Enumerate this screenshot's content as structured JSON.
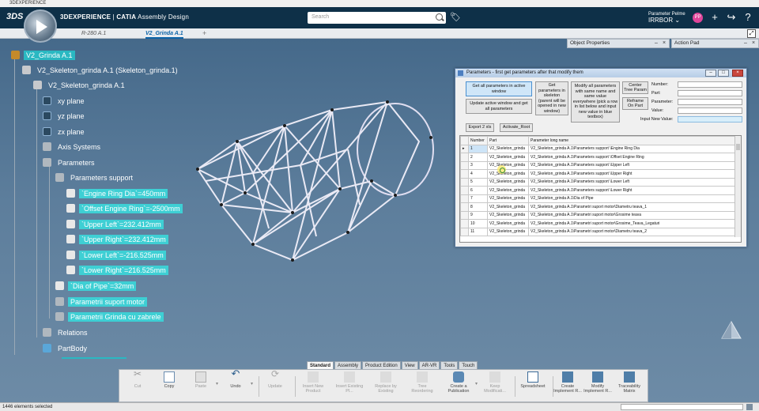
{
  "window": {
    "title": "3DEXPERIENCE"
  },
  "header": {
    "logo": "3DS",
    "brand": "3DEXPERIENCE",
    "app": "CATIA",
    "app_sub": "Assembly Design",
    "search_placeholder": "Search",
    "user_name": "Parameter Pelme",
    "user_org": "IRRBOR",
    "avatar_initials": "PP"
  },
  "tabs": [
    {
      "label": "R-280 A.1",
      "active": false
    },
    {
      "label": "V2_Grinda A.1",
      "active": true
    }
  ],
  "tab_add": "+",
  "panels": {
    "object_properties": "Object Properties",
    "action_pad": "Action Pad"
  },
  "tree": {
    "root": "V2_Grinda A.1",
    "skeleton_inst": "V2_Skeleton_grinda A.1 (Skeleton_grinda.1)",
    "skeleton": "V2_Skeleton_grinda A.1",
    "xy": "xy plane",
    "yz": "yz plane",
    "zx": "zx plane",
    "axis": "Axis Systems",
    "parameters": "Parameters",
    "param_support": "Parameters support",
    "p1": "`Engine Ring Dia`=450mm",
    "p2": "`Offset Engine Ring`=-2500mm",
    "p3": "`Upper Left`=232.412mm",
    "p4": "`Upper Right`=232.412mm",
    "p5": "`Lower Left`=-216.525mm",
    "p6": "`Lower Right`=216.525mm",
    "dia_pipe": "`Dia of Pipe`=32mm",
    "pm_motor": "Parametrii suport motor",
    "pm_grinda": "Parametrii Grinda cu zabrele",
    "relations": "Relations",
    "partbody": "PartBody"
  },
  "dialog": {
    "title": "Parameters - first get parameters after that modify them",
    "btn_get_all": "Get all parameters in active window",
    "btn_update": "Update active window and get all parameters",
    "btn_get_skel": "Get parameters in skeleton (parent will be opened in new window)",
    "btn_modify": "Modify all parameters with same name and same value everywhere (pick a row in list below and input new value in blue textbox)",
    "btn_center": "Center Tree Param",
    "btn_reframe": "Reframe On Part",
    "lbl_number": "Number:",
    "lbl_part": "Part:",
    "lbl_parameter": "Parameter:",
    "lbl_value": "Value:",
    "lbl_new_value": "Input New Value:",
    "btn_export": "Export 2 xls",
    "btn_activate": "Activate_Root",
    "columns": [
      "Number",
      "Part",
      "Parameter long name"
    ],
    "rows": [
      [
        "1",
        "V2_Skeleton_grinda",
        "V2_Skeleton_grinda A.1\\Parameters support \\Engine Ring Dia"
      ],
      [
        "2",
        "V2_Skeleton_grinda",
        "V2_Skeleton_grinda A.1\\Parameters support \\Offset Engine Ring"
      ],
      [
        "3",
        "V2_Skeleton_grinda",
        "V2_Skeleton_grinda A.1\\Parameters support \\Upper Left"
      ],
      [
        "4",
        "V2_Skeleton_grinda",
        "V2_Skeleton_grinda A.1\\Parameters support \\Upper Right"
      ],
      [
        "5",
        "V2_Skeleton_grinda",
        "V2_Skeleton_grinda A.1\\Parameters support \\Lower Left"
      ],
      [
        "6",
        "V2_Skeleton_grinda",
        "V2_Skeleton_grinda A.1\\Parameters support \\Lower Right"
      ],
      [
        "7",
        "V2_Skeleton_grinda",
        "V2_Skeleton_grinda A.1\\Dia of Pipe"
      ],
      [
        "8",
        "V2_Skeleton_grinda",
        "V2_Skeleton_grinda A.1\\Parametri suport motor\\Diametru teava_1"
      ],
      [
        "9",
        "V2_Skeleton_grinda",
        "V2_Skeleton_grinda A.1\\Parametri suport motor\\Grosime teava"
      ],
      [
        "10",
        "V2_Skeleton_grinda",
        "V2_Skeleton_grinda A.1\\Parametri suport motor\\Grosime_Teava_Legaturi"
      ],
      [
        "11",
        "V2_Skeleton_grinda",
        "V2_Skeleton_grinda A.1\\Parametri suport motor\\Diametru teava_2"
      ]
    ]
  },
  "action_tabs": [
    "Standard",
    "Assembly",
    "Product Edition",
    "View",
    "AR-VR",
    "Tools",
    "Touch"
  ],
  "actions": {
    "cut": "Cut",
    "copy": "Copy",
    "paste": "Paste",
    "undo": "Undo",
    "update": "Update",
    "insert_new": "Insert New Product",
    "insert_existing": "Insert Existing Pl...",
    "replace": "Replace by Existing",
    "tree_reorder": "Tree Reordering",
    "create_pub": "Create a Publication",
    "keep_mod": "Keep Modificati...",
    "spreadsheet": "Spreadsheet",
    "create_impl": "Create Implement R...",
    "modify_impl": "Modify Implement R...",
    "trace": "Traceability Matrix"
  },
  "status": {
    "text": "1446 elements selected"
  },
  "colors": {
    "header": "#0e3048",
    "selection": "#2ab8c2",
    "viewport": "#5d7e9c"
  }
}
